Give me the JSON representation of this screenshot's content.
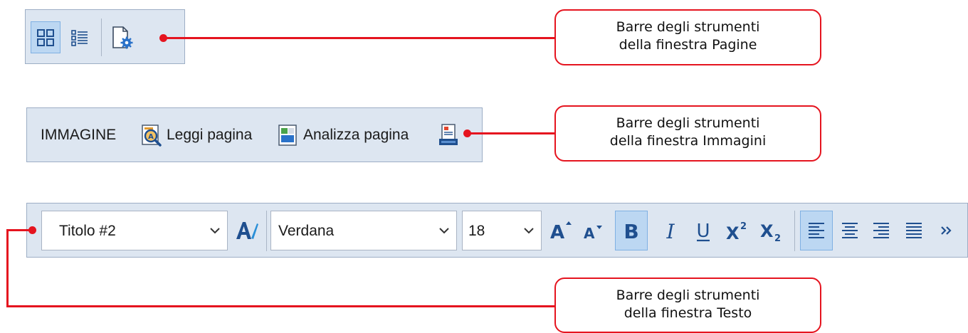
{
  "pages_toolbar": {
    "buttons": [
      {
        "icon": "thumbnails-view-icon",
        "active": true
      },
      {
        "icon": "details-view-icon",
        "active": false
      },
      {
        "icon": "page-properties-icon",
        "active": false
      }
    ]
  },
  "images_toolbar": {
    "title": "IMMAGINE",
    "read_page": {
      "label": "Leggi pagina",
      "icon": "read-page-icon"
    },
    "analyze_page": {
      "label": "Analizza pagina",
      "icon": "analyze-page-icon"
    },
    "scan_icon": "scan-page-icon"
  },
  "text_toolbar": {
    "style_value": "Titolo #2",
    "font_value": "Verdana",
    "size_value": "18",
    "format_buttons": [
      {
        "icon": "increase-font-icon"
      },
      {
        "icon": "decrease-font-icon"
      },
      {
        "icon": "bold-icon",
        "active": true
      },
      {
        "icon": "italic-icon"
      },
      {
        "icon": "underline-icon"
      },
      {
        "icon": "superscript-icon"
      },
      {
        "icon": "subscript-icon"
      },
      {
        "icon": "align-left-icon",
        "active": true
      },
      {
        "icon": "align-center-icon"
      },
      {
        "icon": "align-right-icon"
      },
      {
        "icon": "justify-icon"
      },
      {
        "icon": "more-icon"
      }
    ]
  },
  "callouts": {
    "pages": {
      "line1": "Barre degli strumenti",
      "line2": "della finestra Pagine"
    },
    "images": {
      "line1": "Barre degli strumenti",
      "line2": "della finestra Immagini"
    },
    "text": {
      "line1": "Barre degli strumenti",
      "line2": "della finestra Testo"
    }
  },
  "colors": {
    "toolbar_bg": "#dde6f1",
    "accent_red": "#e5141f",
    "active_blue": "#bcd7f2",
    "icon_blue": "#1f4f8f"
  }
}
